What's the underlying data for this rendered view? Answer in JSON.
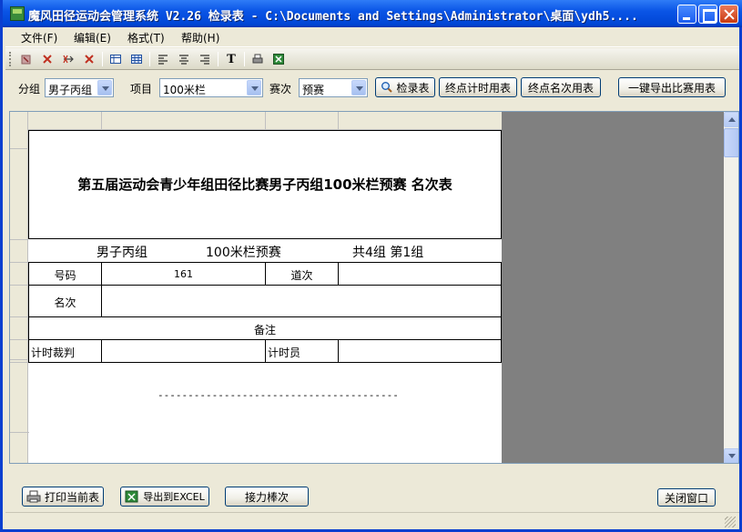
{
  "window": {
    "title": "魔风田径运动会管理系统 V2.26 检录表  - C:\\Documents and Settings\\Administrator\\桌面\\ydh5...."
  },
  "menu": {
    "items": [
      "文件(F)",
      "编辑(E)",
      "格式(T)",
      "帮助(H)"
    ]
  },
  "toolbar": {
    "icons": [
      "pointer-icon",
      "delete-icon",
      "insert-row-icon",
      "delete-row-icon",
      "table-icon",
      "grid-icon",
      "align-left-icon",
      "align-center-icon",
      "align-right-icon",
      "text-icon",
      "print-icon",
      "excel-icon"
    ],
    "text_glyph": "T"
  },
  "filters": {
    "group_label": "分组",
    "group_value": "男子丙组",
    "event_label": "项目",
    "event_value": "100米栏",
    "round_label": "赛次",
    "round_value": "预赛",
    "checkin_button": "检录表",
    "finish_timing_button": "终点计时用表",
    "finish_rank_button": "终点名次用表",
    "export_all_button": "一键导出比赛用表"
  },
  "sheet": {
    "title": "第五届运动会青少年组田径比赛男子丙组100米栏预赛  名次表",
    "subtitle_group": "男子丙组",
    "subtitle_event": "100米栏预赛",
    "subtitle_heat": "共4组  第1组",
    "row_number_label": "号码",
    "row_number_value": "161",
    "row_lane_label": "道次",
    "row_rank_label": "名次",
    "remark_label": "备注",
    "judge_label": "计时裁判",
    "timer_label": "计时员",
    "dash_line": "----------------------------------------"
  },
  "bottom": {
    "print_button": "打印当前表",
    "export_button": "导出到EXCEL",
    "relay_button": "接力棒次",
    "close_button": "关闭窗口"
  },
  "colors": {
    "titlebar": "#0a55e6",
    "chrome": "#ece9d8",
    "canvas_gray": "#808080"
  }
}
